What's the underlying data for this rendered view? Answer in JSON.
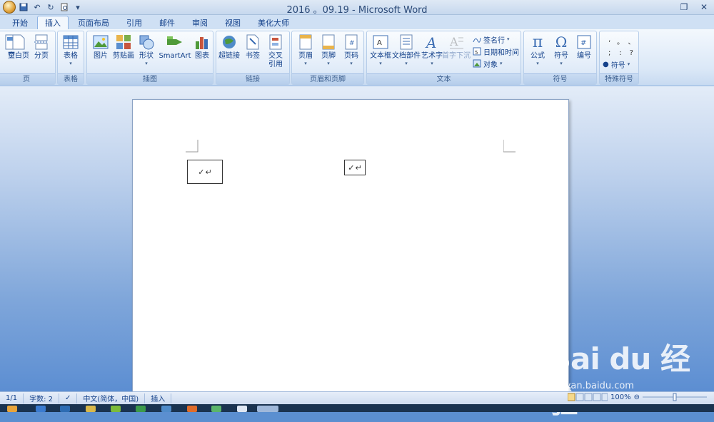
{
  "window": {
    "title": "2016 。09.19 - Microsoft Word"
  },
  "tabs": [
    {
      "label": "开始"
    },
    {
      "label": "插入"
    },
    {
      "label": "页面布局"
    },
    {
      "label": "引用"
    },
    {
      "label": "邮件"
    },
    {
      "label": "审阅"
    },
    {
      "label": "视图"
    },
    {
      "label": "美化大师"
    }
  ],
  "ribbon": {
    "groups": {
      "page": "页",
      "table": "表格",
      "illustrations": "插图",
      "links": "链接",
      "header_footer": "页眉和页脚",
      "text": "文本",
      "symbols": "符号",
      "special": "特殊符号"
    },
    "buttons": {
      "cover": "页",
      "blank_page": "空白页",
      "page_break": "分页",
      "table": "表格",
      "picture": "图片",
      "clipart": "剪贴画",
      "shapes": "形状",
      "smartart": "SmartArt",
      "chart": "图表",
      "hyperlink": "超链接",
      "bookmark": "书签",
      "crossref_1": "交叉",
      "crossref_2": "引用",
      "header": "页眉",
      "footer": "页脚",
      "page_number": "页码",
      "textbox": "文本框",
      "quickparts": "文档部件",
      "wordart": "艺术字",
      "dropcap": "首字下沉",
      "signature": "签名行",
      "datetime": "日期和时间",
      "object": "对象",
      "equation": "公式",
      "symbol": "符号",
      "numbering": "编号",
      "special_symbol": "符号"
    },
    "special_symbols": [
      ",",
      "。",
      "、",
      ";",
      ":",
      "?"
    ]
  },
  "document": {
    "frame1_text": "↵",
    "frame2_text": "↵"
  },
  "status": {
    "page": "1/1",
    "word_count": "字数: 2",
    "language": "中文(简体，中国)",
    "mode": "插入",
    "zoom": "100%"
  },
  "watermark": {
    "brand": "Bai du 经验",
    "url": "jingyan.baidu.com"
  }
}
